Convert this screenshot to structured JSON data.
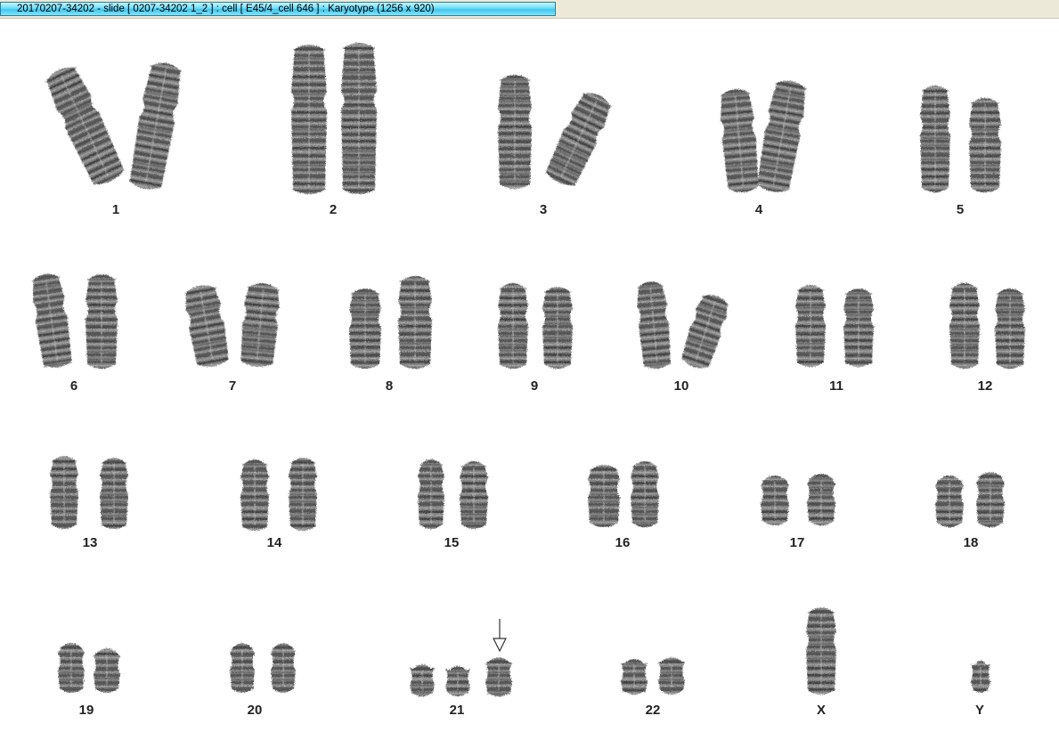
{
  "window": {
    "title": "20170207-34202 - slide [ 0207-34202 1_2 ] : cell [ E45/4_cell 646 ] : Karyotype  (1256 x 920)"
  },
  "karyotype": {
    "labels": [
      "1",
      "2",
      "3",
      "4",
      "5",
      "6",
      "7",
      "8",
      "9",
      "10",
      "11",
      "12",
      "13",
      "14",
      "15",
      "16",
      "17",
      "18",
      "19",
      "20",
      "21",
      "22",
      "X",
      "Y"
    ],
    "marker": {
      "type": "down-arrow",
      "chromosome": "21"
    }
  },
  "colors": {
    "tab_highlight": "#3ec6ee",
    "chromatin": "#3a3a3a",
    "label": "#222222"
  }
}
